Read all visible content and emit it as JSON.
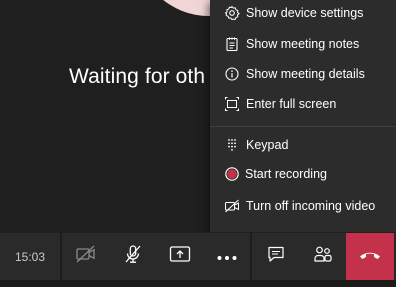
{
  "stage": {
    "waiting_text": "Waiting for oth"
  },
  "menu": {
    "items": [
      {
        "label": "Show device settings",
        "icon": "gear-icon"
      },
      {
        "label": "Show meeting notes",
        "icon": "notes-icon"
      },
      {
        "label": "Show meeting details",
        "icon": "info-icon"
      },
      {
        "label": "Enter full screen",
        "icon": "fullscreen-icon"
      },
      {
        "label": "Keypad",
        "icon": "keypad-icon"
      },
      {
        "label": "Start recording",
        "icon": "record-icon"
      },
      {
        "label": "Turn off incoming video",
        "icon": "video-off-icon"
      }
    ]
  },
  "toolbar": {
    "timer": "15:03",
    "buttons": [
      "camera-off-icon",
      "mic-off-icon",
      "share-screen-icon",
      "more-options-icon",
      "chat-icon",
      "participants-icon",
      "hang-up-icon"
    ]
  },
  "colors": {
    "hangup": "#c4314b",
    "record_dot": "#c4314b",
    "avatar": "#f1d5d5"
  }
}
